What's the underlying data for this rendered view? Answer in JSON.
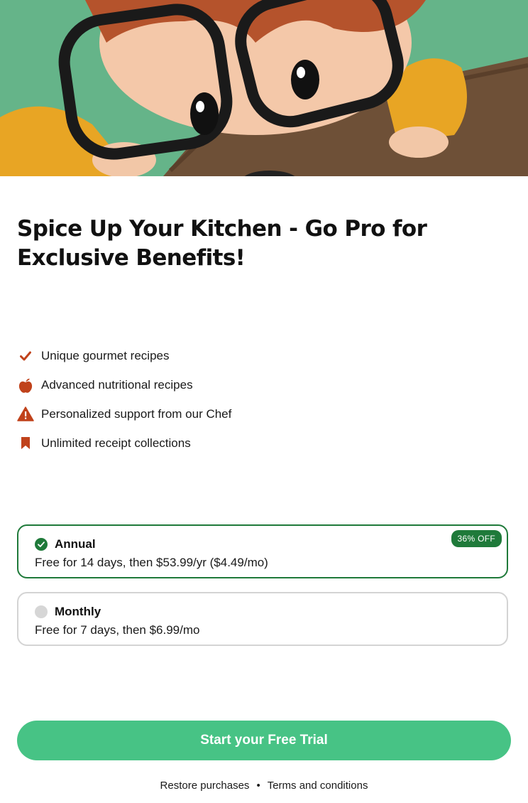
{
  "colors": {
    "accent_red": "#c0421b",
    "selected_green": "#1f7a3a",
    "cta_green": "#47c385",
    "hero_green": "#5fae84"
  },
  "hero": {
    "image": "illustrated child with large glasses peeking over a wooden counter"
  },
  "title": "Spice Up Your Kitchen - Go Pro for Exclusive Benefits!",
  "features": [
    {
      "icon": "checkmark-icon",
      "label": "Unique gourmet recipes"
    },
    {
      "icon": "apple-icon",
      "label": "Advanced nutritional recipes"
    },
    {
      "icon": "warning-triangle-icon",
      "label": "Personalized support from our Chef"
    },
    {
      "icon": "bookmark-icon",
      "label": "Unlimited receipt collections"
    }
  ],
  "plans": {
    "annual": {
      "name": "Annual",
      "detail": "Free for 14 days, then $53.99/yr ($4.49/mo)",
      "badge": "36% OFF",
      "selected": true
    },
    "monthly": {
      "name": "Monthly",
      "detail": "Free for 7 days, then $6.99/mo",
      "selected": false
    }
  },
  "cta": {
    "label": "Start your Free Trial"
  },
  "footer": {
    "restore": "Restore purchases",
    "separator": "•",
    "terms": "Terms and conditions"
  }
}
